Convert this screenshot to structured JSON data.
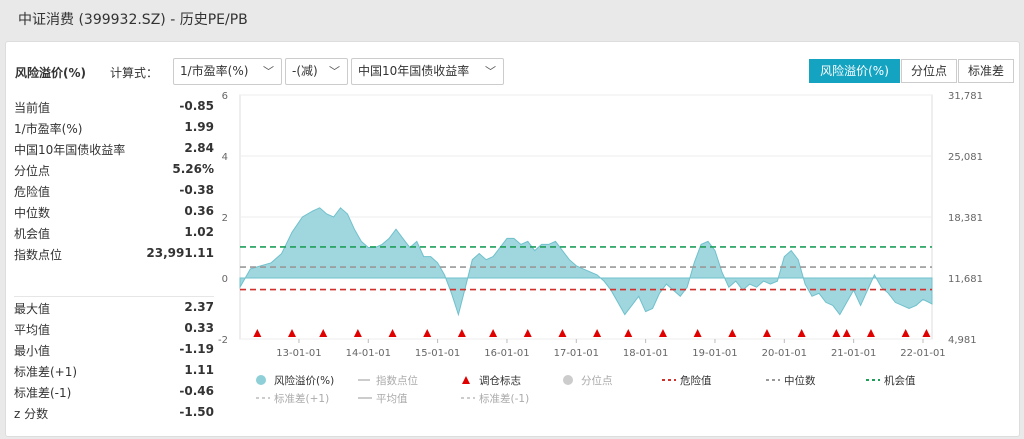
{
  "header": {
    "title": "中证消费 (399932.SZ) - 历史PE/PB"
  },
  "toolbar": {
    "title": "风险溢价(%)",
    "formula_label": "计算式：",
    "dropdowns": [
      "1/市盈率(%)",
      "-(减)",
      "中国10年国债收益率"
    ],
    "tabs": [
      "风险溢价(%)",
      "分位点",
      "标准差"
    ],
    "active_tab": 0
  },
  "stats_top": [
    {
      "label": "当前值",
      "value": "-0.85"
    },
    {
      "label": "1/市盈率(%)",
      "value": "1.99"
    },
    {
      "label": "中国10年国债收益率",
      "value": "2.84"
    },
    {
      "label": "分位点",
      "value": "5.26%"
    },
    {
      "label": "危险值",
      "value": "-0.38"
    },
    {
      "label": "中位数",
      "value": "0.36"
    },
    {
      "label": "机会值",
      "value": "1.02"
    },
    {
      "label": "指数点位",
      "value": "23,991.11"
    }
  ],
  "stats_bottom": [
    {
      "label": "最大值",
      "value": "2.37"
    },
    {
      "label": "平均值",
      "value": "0.33"
    },
    {
      "label": "最小值",
      "value": "-1.19"
    },
    {
      "label": "标准差(+1)",
      "value": "1.11"
    },
    {
      "label": "标准差(-1)",
      "value": "-0.46"
    },
    {
      "label": "z 分数",
      "value": "-1.50"
    }
  ],
  "colors": {
    "accent": "#15a3c2",
    "area_fill": "#8fd0d8",
    "area_stroke": "#6fc0cc",
    "danger": "#d0312d",
    "median": "#999999",
    "opportunity": "#1f9e5a",
    "marker": "#e00000"
  },
  "chart_data": {
    "type": "area",
    "y_left_ticks": [
      "6",
      "4",
      "2",
      "0",
      "-2"
    ],
    "y_left_range": [
      -2,
      6
    ],
    "y_right_ticks": [
      "31,781",
      "25,081",
      "18,381",
      "11,681",
      "4,981"
    ],
    "y_right_range": [
      4981,
      31781
    ],
    "x_ticks": [
      "13-01-01",
      "14-01-01",
      "15-01-01",
      "16-01-01",
      "17-01-01",
      "18-01-01",
      "19-01-01",
      "20-01-01",
      "21-01-01",
      "22-01-01"
    ],
    "x_range": [
      2012.15,
      2022.13
    ],
    "series": [
      {
        "name": "风险溢价(%)",
        "x": [
          2012.15,
          2012.3,
          2012.45,
          2012.6,
          2012.75,
          2012.9,
          2013.05,
          2013.2,
          2013.3,
          2013.4,
          2013.5,
          2013.6,
          2013.7,
          2013.8,
          2013.9,
          2014.0,
          2014.1,
          2014.2,
          2014.3,
          2014.4,
          2014.5,
          2014.6,
          2014.7,
          2014.8,
          2014.9,
          2015.0,
          2015.1,
          2015.2,
          2015.3,
          2015.4,
          2015.5,
          2015.6,
          2015.7,
          2015.8,
          2015.9,
          2016.0,
          2016.1,
          2016.2,
          2016.3,
          2016.4,
          2016.5,
          2016.6,
          2016.7,
          2016.8,
          2016.9,
          2017.0,
          2017.1,
          2017.2,
          2017.3,
          2017.4,
          2017.5,
          2017.6,
          2017.7,
          2017.8,
          2017.9,
          2018.0,
          2018.1,
          2018.2,
          2018.3,
          2018.4,
          2018.5,
          2018.6,
          2018.7,
          2018.8,
          2018.9,
          2019.0,
          2019.1,
          2019.2,
          2019.3,
          2019.4,
          2019.5,
          2019.6,
          2019.7,
          2019.8,
          2019.9,
          2020.0,
          2020.1,
          2020.2,
          2020.3,
          2020.4,
          2020.5,
          2020.6,
          2020.7,
          2020.8,
          2020.9,
          2021.0,
          2021.1,
          2021.2,
          2021.3,
          2021.4,
          2021.5,
          2021.6,
          2021.7,
          2021.8,
          2021.9,
          2022.0,
          2022.13
        ],
        "values": [
          -0.3,
          0.3,
          0.4,
          0.5,
          0.8,
          1.5,
          2.0,
          2.2,
          2.3,
          2.1,
          2.0,
          2.3,
          2.1,
          1.6,
          1.2,
          1.0,
          1.0,
          1.1,
          1.3,
          1.6,
          1.3,
          1.0,
          1.2,
          0.7,
          0.7,
          0.5,
          0.1,
          -0.5,
          -1.2,
          -0.3,
          0.6,
          0.8,
          0.6,
          0.7,
          1.0,
          1.3,
          1.3,
          1.1,
          1.2,
          0.9,
          1.1,
          1.1,
          1.2,
          0.9,
          0.6,
          0.4,
          0.3,
          0.2,
          0.1,
          -0.1,
          -0.4,
          -0.8,
          -1.2,
          -0.9,
          -0.6,
          -1.1,
          -1.0,
          -0.5,
          -0.2,
          -0.4,
          -0.6,
          -0.3,
          0.5,
          1.1,
          1.2,
          0.9,
          0.2,
          -0.3,
          -0.1,
          -0.4,
          -0.2,
          -0.3,
          -0.1,
          -0.2,
          -0.1,
          0.7,
          0.9,
          0.6,
          -0.2,
          -0.6,
          -0.5,
          -0.8,
          -0.9,
          -1.2,
          -0.8,
          -0.4,
          -0.9,
          -0.4,
          0.1,
          -0.3,
          -0.5,
          -0.8,
          -0.9,
          -1.0,
          -0.9,
          -0.7,
          -0.85
        ]
      }
    ],
    "reference_lines": [
      {
        "name": "危险值",
        "value": -0.38
      },
      {
        "name": "中位数",
        "value": 0.36
      },
      {
        "name": "机会值",
        "value": 1.02
      }
    ],
    "rebalance_markers_x": [
      2012.4,
      2012.9,
      2013.35,
      2013.85,
      2014.35,
      2014.85,
      2015.35,
      2015.8,
      2016.3,
      2016.8,
      2017.3,
      2017.75,
      2018.25,
      2018.75,
      2019.25,
      2019.75,
      2020.25,
      2020.75,
      2020.9,
      2021.25,
      2021.75,
      2022.05
    ],
    "legend": {
      "row1": [
        "风险溢价(%)",
        "指数点位",
        "调仓标志",
        "分位点",
        "危险值",
        "中位数",
        "机会值"
      ],
      "row2": [
        "标准差(+1)",
        "平均值",
        "标准差(-1)"
      ]
    }
  }
}
